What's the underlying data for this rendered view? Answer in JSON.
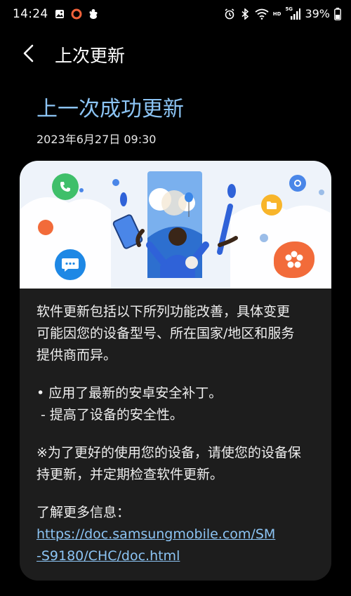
{
  "status_bar": {
    "time": "14:24",
    "battery": "39%",
    "network_hd": "HD",
    "network_5g": "5G",
    "left_icons": [
      "image-icon",
      "ring-icon",
      "hand-icon"
    ],
    "right_icons": [
      "alarm-icon",
      "bluetooth-icon",
      "wifi-icon",
      "signal-icon",
      "battery-icon"
    ]
  },
  "header": {
    "title": "上次更新",
    "back_icon": "back-arrow-icon"
  },
  "update": {
    "headline": "上一次成功更新",
    "date": "2023年6月27日 09:30"
  },
  "illustration": {
    "icons": [
      "phone-app-icon",
      "chat-bubble-icon",
      "folder-icon",
      "flower-icon",
      "settings-icon"
    ]
  },
  "content": {
    "intro_line1": "软件更新包括以下所列功能改善，具体变更",
    "intro_line2": "可能因您的设备型号、所在国家/地区和服务",
    "intro_line3": "提供商而异。",
    "bullet_main": "• 应用了最新的安卓安全补丁。",
    "bullet_sub": " - 提高了设备的安全性。",
    "note_line1": "※为了更好的使用您的设备，请使您的设备保",
    "note_line2": "持更新，并定期检查软件更新。",
    "more_info_label": "了解更多信息：",
    "link_line1": "https://doc.samsungmobile.com/SM",
    "link_line2": "-S9180/CHC/doc.html"
  },
  "colors": {
    "background": "#000000",
    "card": "#1d1d1d",
    "accent": "#8cc4f4",
    "text": "#efefef"
  }
}
